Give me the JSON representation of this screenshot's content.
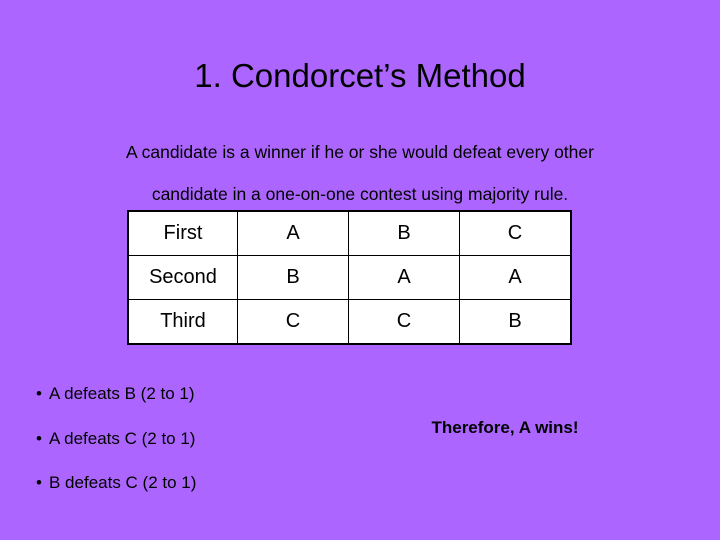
{
  "slide": {
    "background_color": "#ac66ff",
    "text_color": "#000000",
    "title": "1. Condorcet’s Method"
  },
  "definition": {
    "line1": "A candidate is a winner if he or she would defeat every other",
    "line2": "candidate in a one-on-one contest using majority rule."
  },
  "preference_table": {
    "border_color": "#000000",
    "cell_background": "#ffffff",
    "rows": [
      {
        "rank": "First",
        "ballots": [
          "A",
          "B",
          "C"
        ]
      },
      {
        "rank": "Second",
        "ballots": [
          "B",
          "A",
          "A"
        ]
      },
      {
        "rank": "Third",
        "ballots": [
          "C",
          "C",
          "B"
        ]
      }
    ]
  },
  "comparisons": {
    "bullet_glyph": "•",
    "items": [
      "A defeats B (2 to 1)",
      "A defeats C (2 to 1)",
      "B defeats C (2 to 1)"
    ]
  },
  "conclusion": {
    "text": "Therefore, A wins!"
  }
}
